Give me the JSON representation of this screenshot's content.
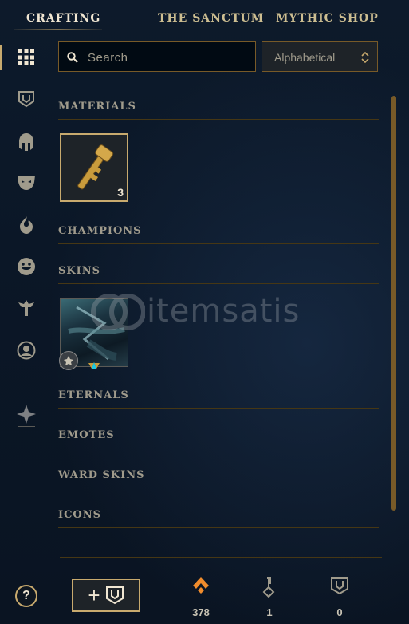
{
  "nav": {
    "tabs": [
      {
        "label": "CRAFTING",
        "active": true
      },
      {
        "label": "THE SANCTUM"
      },
      {
        "label": "MYTHIC SHOP"
      }
    ]
  },
  "rail": {
    "items": [
      "grid-icon",
      "chest-icon",
      "helmet-icon",
      "mask-icon",
      "flame-icon",
      "emote-face-icon",
      "ward-icon",
      "profile-icon",
      "sparkle-icon"
    ]
  },
  "search": {
    "placeholder": "Search"
  },
  "sort": {
    "selected": "Alphabetical"
  },
  "sections": [
    {
      "title": "MATERIALS"
    },
    {
      "title": "CHAMPIONS"
    },
    {
      "title": "SKINS"
    },
    {
      "title": "ETERNALS"
    },
    {
      "title": "EMOTES"
    },
    {
      "title": "WARD SKINS"
    },
    {
      "title": "ICONS"
    }
  ],
  "materials": [
    {
      "name": "key-fragment",
      "count": "3"
    }
  ],
  "watermark": {
    "text": "itemsatis"
  },
  "footer": {
    "help_label": "?",
    "add_label": "+",
    "currencies": [
      {
        "icon": "orange-essence-icon",
        "value": "378"
      },
      {
        "icon": "key-icon",
        "value": "1"
      },
      {
        "icon": "chest-icon",
        "value": "0"
      }
    ]
  },
  "colors": {
    "gold": "#c8aa6e",
    "dark_gold": "#785a28",
    "text": "#a09b8c",
    "essence": "#f08c2c"
  }
}
